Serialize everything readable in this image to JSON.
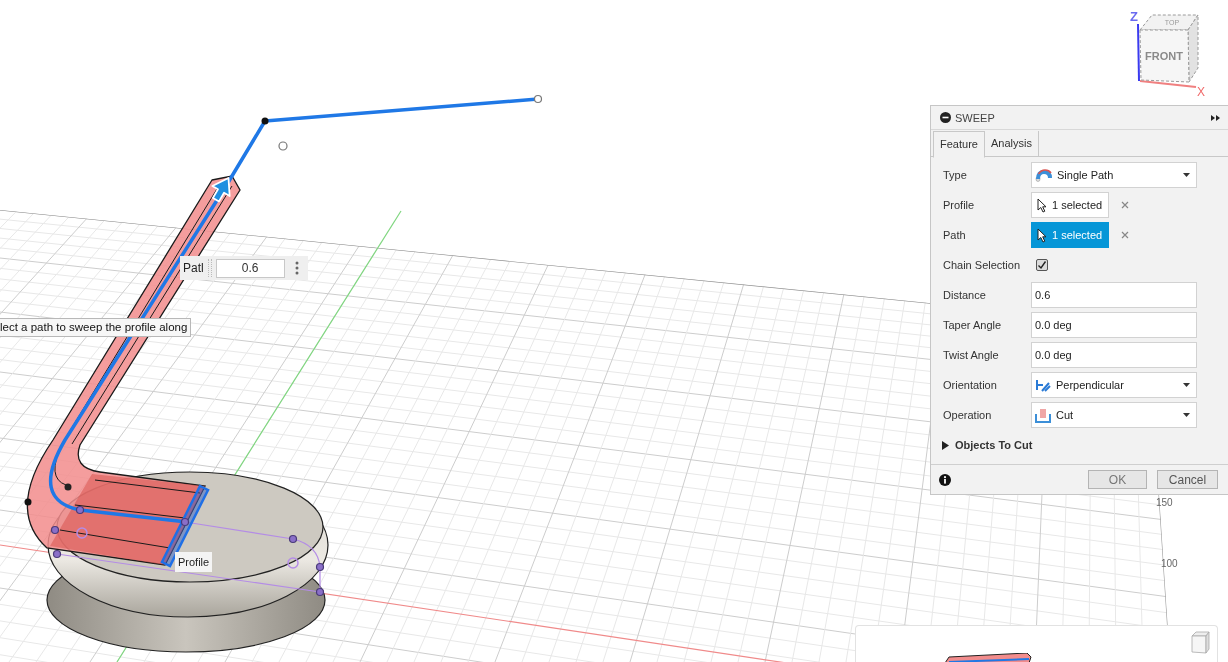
{
  "viewport": {
    "view_cube": {
      "z_label": "Z",
      "top_label": "TOP",
      "front_label": "FRONT",
      "x_label": "X"
    },
    "axis_labels": [
      "150",
      "100"
    ],
    "manipulator": {
      "label": "Patl",
      "value": "0.6"
    },
    "tooltip": "lect a path to sweep the profile along",
    "profile_tag": "Profile"
  },
  "dialog": {
    "title": "SWEEP",
    "tabs": [
      {
        "label": "Feature",
        "selected": true
      },
      {
        "label": "Analysis",
        "selected": false
      }
    ],
    "rows": [
      {
        "kind": "dropdown",
        "label": "Type",
        "value": "Single Path"
      },
      {
        "kind": "selection",
        "label": "Profile",
        "value": "1 selected",
        "selected": false
      },
      {
        "kind": "selection",
        "label": "Path",
        "value": "1 selected",
        "selected": true
      },
      {
        "kind": "checkbox",
        "label": "Chain Selection",
        "checked": true
      },
      {
        "kind": "input",
        "label": "Distance",
        "value": "0.6"
      },
      {
        "kind": "input",
        "label": "Taper Angle",
        "value": "0.0 deg"
      },
      {
        "kind": "input",
        "label": "Twist Angle",
        "value": "0.0 deg"
      },
      {
        "kind": "dropdown",
        "label": "Orientation",
        "value": "Perpendicular"
      },
      {
        "kind": "dropdown",
        "label": "Operation",
        "value": "Cut"
      }
    ],
    "section": {
      "label": "Objects To Cut",
      "expanded": false
    },
    "buttons": [
      "OK",
      "Cancel"
    ]
  }
}
